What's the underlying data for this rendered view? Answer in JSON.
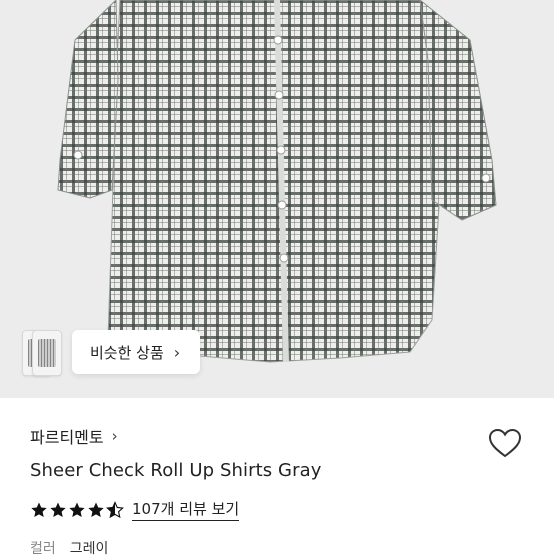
{
  "similar": {
    "label": "비슷한 상품",
    "chevron": "›"
  },
  "product": {
    "brand": "파르티멘토",
    "brand_chevron": "›",
    "title": "Sheer Check Roll Up Shirts Gray",
    "rating": 4.5,
    "review_link": "107개 리뷰 보기",
    "color_label": "컬러",
    "color_value": "그레이"
  },
  "colors": {
    "image_bg": "#ececec",
    "check_dark": "#2f3a36",
    "check_light": "#f3f3f0",
    "star": "#111111"
  },
  "icons": {
    "heart": "heart-outline-icon",
    "star": "star-icon",
    "chevron": "chevron-right-icon"
  }
}
